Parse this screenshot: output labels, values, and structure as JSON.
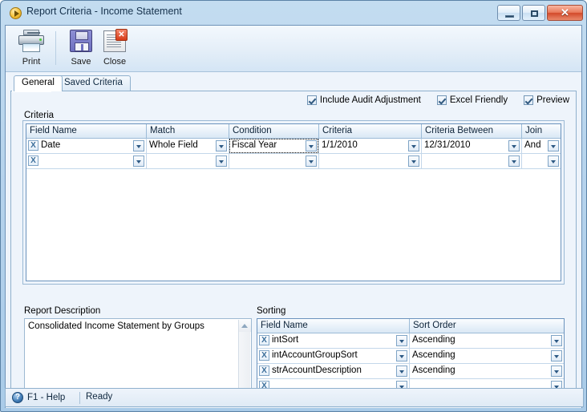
{
  "window": {
    "title": "Report Criteria - Income Statement",
    "app_icon": "orange-play-circle-icon",
    "controls": {
      "minimize_label": "Minimize",
      "maximize_label": "Maximize",
      "close_label": "Close"
    }
  },
  "toolbar": {
    "items": [
      {
        "label": "Print",
        "icon": "printer-icon"
      },
      {
        "label": "Save",
        "icon": "floppy-disk-icon"
      },
      {
        "label": "Close",
        "icon": "page-with-red-x-icon"
      }
    ]
  },
  "tabs": [
    {
      "label": "General",
      "active": true
    },
    {
      "label": "Saved Criteria",
      "active": false
    }
  ],
  "options": [
    {
      "label": "Include Audit Adjustment",
      "checked": true
    },
    {
      "label": "Excel Friendly",
      "checked": true
    },
    {
      "label": "Preview",
      "checked": true
    }
  ],
  "criteria_group": {
    "label": "Criteria",
    "columns": [
      "Field Name",
      "Match",
      "Condition",
      "Criteria",
      "Criteria Between",
      "Join"
    ],
    "rows": [
      {
        "field_name": "Date",
        "match": "Whole Field",
        "condition": "Fiscal Year",
        "criteria": "1/1/2010",
        "criteria_between": "12/31/2010",
        "join": "And",
        "focused_cell": "condition"
      },
      {
        "field_name": "",
        "match": "",
        "condition": "",
        "criteria": "",
        "criteria_between": "",
        "join": "",
        "focused_cell": ""
      }
    ],
    "delete_row_label": "X"
  },
  "report_description": {
    "label": "Report Description",
    "value": "Consolidated Income Statement by Groups"
  },
  "sorting": {
    "label": "Sorting",
    "columns": [
      "Field Name",
      "Sort Order"
    ],
    "rows": [
      {
        "field_name": "intSort",
        "sort_order": "Ascending"
      },
      {
        "field_name": "intAccountGroupSort",
        "sort_order": "Ascending"
      },
      {
        "field_name": "strAccountDescription",
        "sort_order": "Ascending"
      },
      {
        "field_name": "",
        "sort_order": ""
      }
    ],
    "delete_row_label": "X"
  },
  "statusbar": {
    "help_label": "F1 - Help",
    "help_icon": "question-mark-circle-icon",
    "status": "Ready"
  },
  "colors": {
    "frame": "#b6d3ec",
    "accent": "#6b93bd",
    "page_bg": "#eef4fb",
    "grid_bg": "#ffffff",
    "close_button": "#d2492a"
  }
}
